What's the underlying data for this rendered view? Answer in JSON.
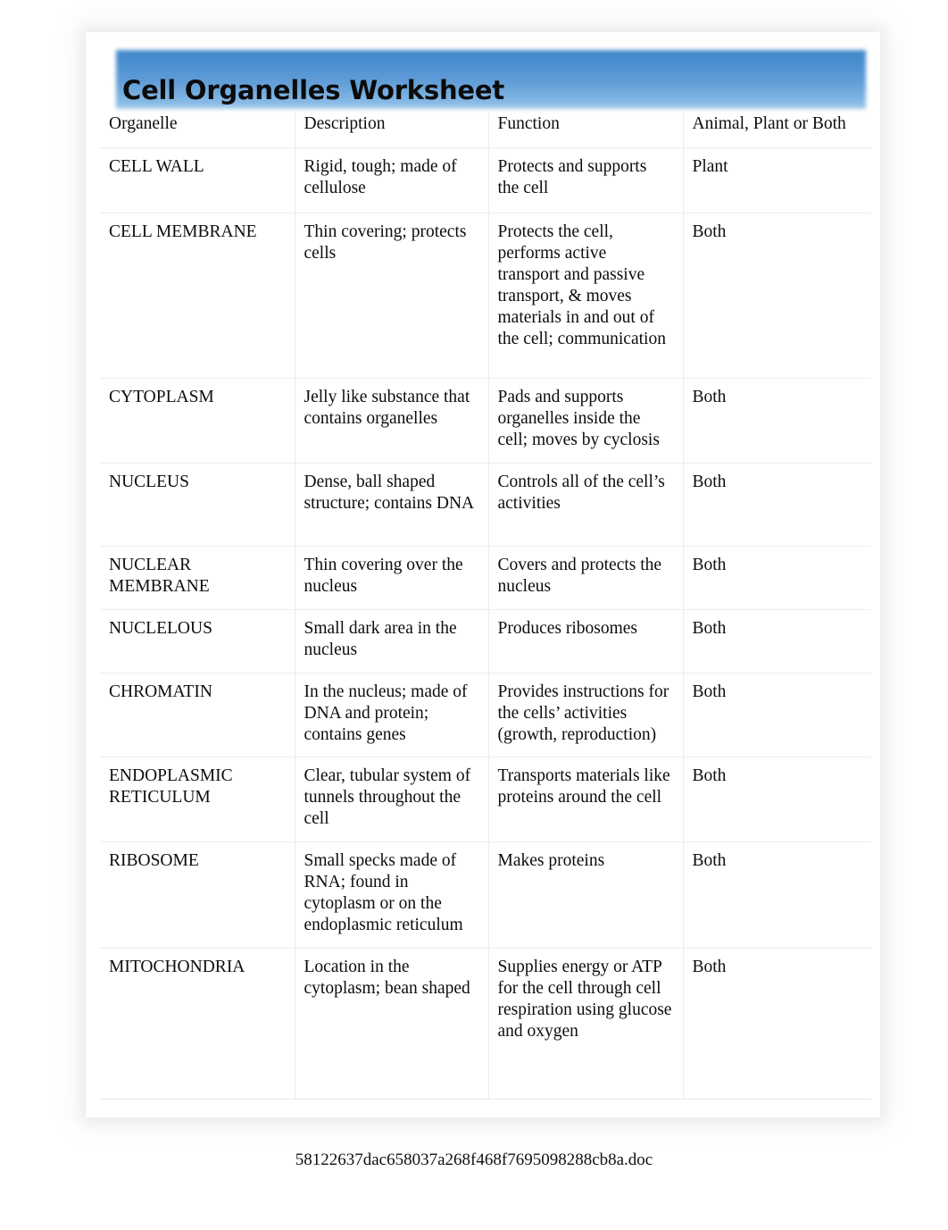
{
  "document": {
    "title": "Cell Organelles Worksheet",
    "banner_color_top": "#3f86c8",
    "banner_color_bottom": "#a7cdec",
    "footer_filename": "58122637dac658037a268f468f7695098288cb8a.doc"
  },
  "table": {
    "headers": {
      "organelle": "Organelle",
      "description": "Description",
      "function": "Function",
      "category": "Animal, Plant or Both"
    },
    "rows": [
      {
        "key": "cell-wall",
        "organelle": "CELL WALL",
        "description": "Rigid, tough; made of cellulose",
        "function": "Protects and supports the cell",
        "category": "Plant"
      },
      {
        "key": "cell-membrane",
        "organelle": "CELL MEMBRANE",
        "description": "Thin covering; protects cells",
        "function": "Protects the cell, performs active transport and passive transport, & moves materials in and out of the cell; communication",
        "category": "Both"
      },
      {
        "key": "cytoplasm",
        "organelle": "CYTOPLASM",
        "description": "Jelly like substance that contains organelles",
        "function": "Pads and supports organelles inside the cell; moves by cyclosis",
        "category": "Both"
      },
      {
        "key": "nucleus",
        "organelle": "NUCLEUS",
        "description": "Dense, ball shaped structure; contains DNA",
        "function": "Controls all of the cell’s activities",
        "category": "Both"
      },
      {
        "key": "nuclear-membrane",
        "organelle": "NUCLEAR MEMBRANE",
        "description": "Thin covering over the nucleus",
        "function": "Covers and protects the nucleus",
        "category": "Both"
      },
      {
        "key": "nucleolus",
        "organelle": "NUCLELOUS",
        "description": "Small dark area in the nucleus",
        "function": "Produces ribosomes",
        "category": "Both"
      },
      {
        "key": "chromatin",
        "organelle": "CHROMATIN",
        "description": "In the nucleus; made of DNA and protein; contains genes",
        "function": "Provides instructions for the cells’ activities (growth, reproduction)",
        "category": "Both"
      },
      {
        "key": "endoplasmic-reticulum",
        "organelle": "ENDOPLASMIC RETICULUM",
        "description": "Clear, tubular system of tunnels throughout the cell",
        "function": "Transports materials like proteins around the cell",
        "category": "Both"
      },
      {
        "key": "ribosome",
        "organelle": "RIBOSOME",
        "description": "Small specks made of RNA; found in cytoplasm or on the endoplasmic reticulum",
        "function": "Makes proteins",
        "category": "Both"
      },
      {
        "key": "mitochondria",
        "organelle": "MITOCHONDRIA",
        "description": "Location in the cytoplasm; bean shaped",
        "function": "Supplies energy or ATP for the cell through cell respiration using glucose and oxygen",
        "category": "Both"
      }
    ]
  }
}
